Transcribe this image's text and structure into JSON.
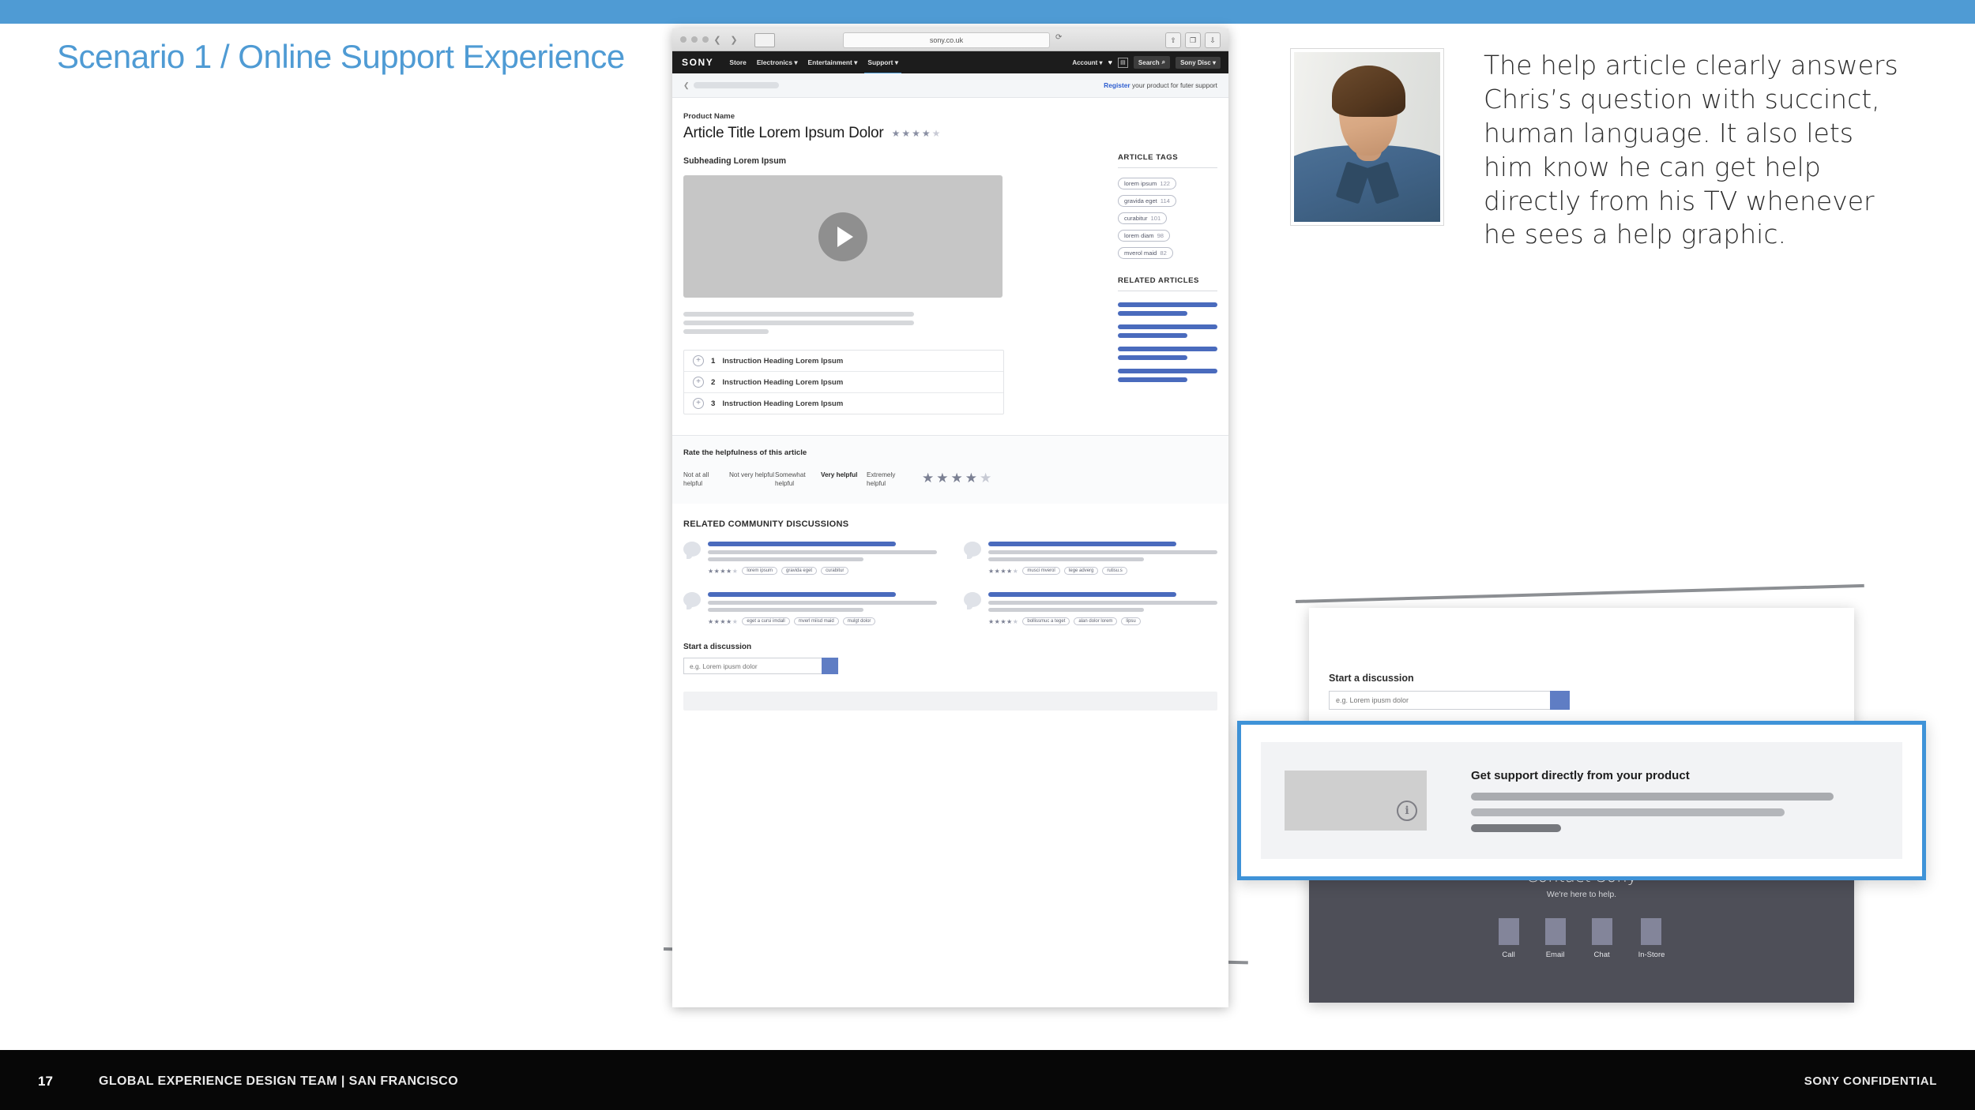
{
  "slide": {
    "title": "Scenario 1 / Online Support Experience",
    "accent_color": "#4f9bd4",
    "page_number": "17",
    "footer_team": "GLOBAL EXPERIENCE DESIGN TEAM | SAN FRANCISCO",
    "footer_confidential": "SONY CONFIDENTIAL"
  },
  "annotation": {
    "text": "The help article clearly answers Chris’s question with succinct, human language. It also lets him know he can get help directly from his TV whenever he sees a help graphic.",
    "photo_alt": "persona-portrait"
  },
  "browser": {
    "url": "sony.co.uk",
    "reload_icon": "⟳",
    "back_icon": "❮",
    "forward_icon": "❯",
    "sidebar_icon": "▣",
    "share_icon": "⇧",
    "tabs_icon": "❐",
    "download_icon": "⇩",
    "new_tab_icon": "+"
  },
  "sony_nav": {
    "logo": "SONY",
    "links": [
      "Store",
      "Electronics ▾",
      "Entertainment ▾",
      "Support ▾"
    ],
    "active_link": "Support ▾",
    "account_label": "Account ▾",
    "wishlist_icon": "♥",
    "cart_icon": "▤",
    "search_label": "Search",
    "search_icon": "⌕",
    "store_button": "Sony Disc ▾"
  },
  "subbar": {
    "breadcrumb_chevron": "❮",
    "register_bold": "Register",
    "register_rest": " your product for futer support"
  },
  "article": {
    "kicker": "Product Name",
    "title": "Article Title Lorem Ipsum Dolor",
    "rating_filled": 4,
    "rating_total": 5,
    "star_glyph": "★",
    "subheading": "Subheading Lorem Ipsum",
    "play_icon": "play-button",
    "instructions": [
      {
        "num": "1",
        "text": "Instruction Heading Lorem Ipsum",
        "expand_icon": "+"
      },
      {
        "num": "2",
        "text": "Instruction Heading Lorem Ipsum",
        "expand_icon": "+"
      },
      {
        "num": "3",
        "text": "Instruction Heading Lorem Ipsum",
        "expand_icon": "+"
      }
    ]
  },
  "article_tags": {
    "heading": "ARTICLE TAGS",
    "items": [
      {
        "label": "lorem ipsum",
        "count": "122"
      },
      {
        "label": "gravida eget",
        "count": "114"
      },
      {
        "label": "curabitur",
        "count": "101"
      },
      {
        "label": "lorem diam",
        "count": "98"
      },
      {
        "label": "mverol maid",
        "count": "82"
      }
    ]
  },
  "related_articles": {
    "heading": "RELATED ARTICLES",
    "count": 4
  },
  "rating": {
    "heading": "Rate the helpfulness of this article",
    "options": [
      "Not at all helpful",
      "Not very helpful",
      "Somewhat helpful",
      "Very helpful",
      "Extremely helpful"
    ],
    "selected": "Very helpful",
    "stars_filled": 4,
    "stars_total": 5
  },
  "community": {
    "heading": "RELATED COMMUNITY DISCUSSIONS",
    "discussions": [
      {
        "stars_filled": 4,
        "tags": [
          "lorem ipsum",
          "gravida eget",
          "curabitur"
        ]
      },
      {
        "stars_filled": 4,
        "tags": [
          "musci mverol",
          "tege adverg",
          "rutisu.s"
        ]
      },
      {
        "stars_filled": 4,
        "tags": [
          "eget a cursi imdall",
          "mverl miisd maid",
          "mulgt dolor"
        ]
      },
      {
        "stars_filled": 4,
        "tags": [
          "bollissmuc a teget",
          "alan dolor lorem",
          "lipsu"
        ]
      }
    ]
  },
  "start_discussion": {
    "label": "Start a discussion",
    "placeholder": "e.g. Lorem ipusm dolor",
    "submit_icon": "submit"
  },
  "tv_panel": {
    "start_label": "Start a discussion",
    "start_placeholder": "e.g. Lorem ipusm dolor"
  },
  "contact": {
    "title": "Contact Sony",
    "subtitle": "We're here to help.",
    "options": [
      "Call",
      "Email",
      "Chat",
      "In-Store"
    ]
  },
  "callout": {
    "heading": "Get support directly from your product",
    "info_icon": "i",
    "border_color": "#3f93d8"
  }
}
